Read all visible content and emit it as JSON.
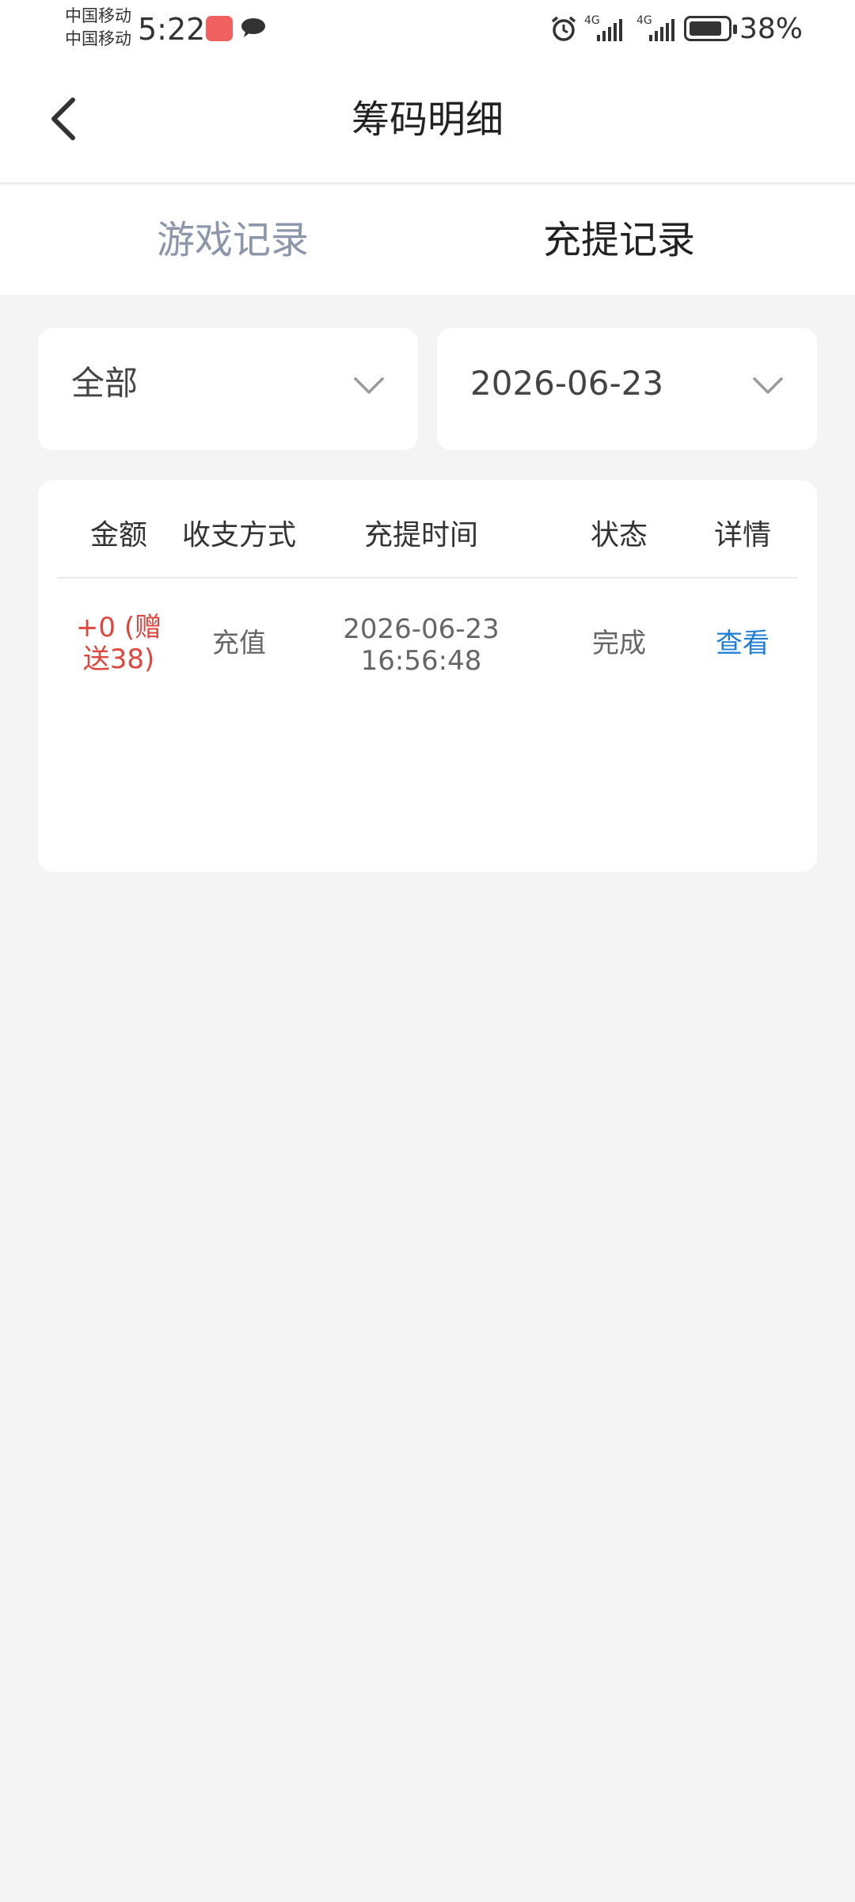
{
  "status_bar": {
    "carrier_1": "中国移动",
    "carrier_2": "中国移动",
    "time": "5:22",
    "battery": "38%"
  },
  "header": {
    "title": "筹码明细",
    "back_icon": "chevron-left-icon"
  },
  "tabs": [
    {
      "label": "游戏记录",
      "active": false
    },
    {
      "label": "充提记录",
      "active": true
    }
  ],
  "filters": {
    "type": {
      "value": "全部"
    },
    "date": {
      "value": "2026-06-23"
    }
  },
  "table": {
    "headers": [
      "金额",
      "收支方式",
      "充提时间",
      "状态",
      "详情"
    ],
    "rows": [
      {
        "amount_line1": "+0 (赠",
        "amount_line2": "送38)",
        "method": "充值",
        "date": "2026-06-23",
        "time": "16:56:48",
        "status": "完成",
        "detail": "查看"
      }
    ]
  },
  "colors": {
    "accent_link": "#1f7fd6",
    "amount": "#e0463d",
    "tab_inactive": "#8c97ab",
    "background": "#f4f4f4"
  }
}
